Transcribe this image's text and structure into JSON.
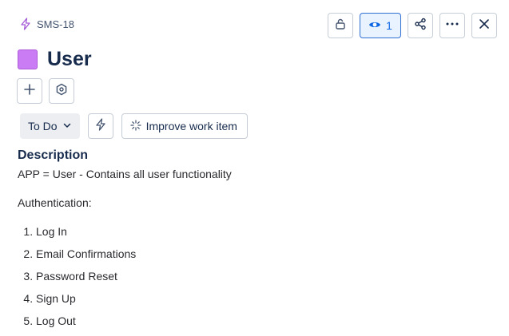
{
  "breadcrumb": {
    "issue_key": "SMS-18"
  },
  "header": {
    "watchers_count": "1"
  },
  "issue": {
    "type_color": "#c97cf4",
    "title": "User"
  },
  "status": {
    "label": "To Do"
  },
  "improve": {
    "label": "Improve work item"
  },
  "description": {
    "heading": "Description",
    "intro": "APP = User - Contains all user functionality",
    "section": "Authentication:",
    "items": [
      "Log In",
      "Email Confirmations",
      "Password Reset",
      "Sign Up",
      "Log Out"
    ]
  },
  "icons": {
    "breadcrumb": "lightning-icon",
    "lock": "unlock-icon",
    "watch": "eye-icon",
    "share": "share-icon",
    "more": "more-icon",
    "close": "close-icon",
    "add": "plus-icon",
    "apps": "hexagon-icon",
    "automation": "lightning-icon",
    "ai": "sparkle-icon",
    "dropdown": "chevron-down-icon"
  }
}
